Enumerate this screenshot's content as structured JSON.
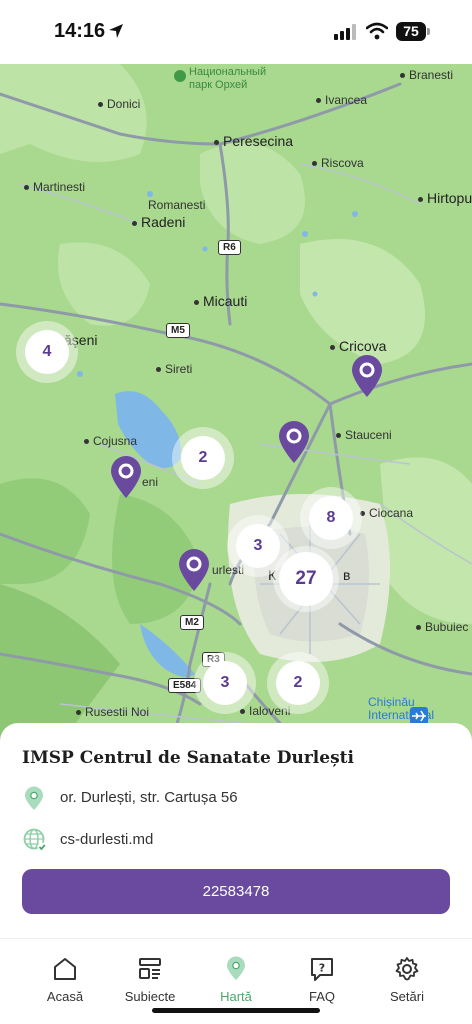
{
  "status": {
    "time": "14:16",
    "battery": "75"
  },
  "map": {
    "park": {
      "line1": "Национальный",
      "line2": "парк Орхей"
    },
    "places": [
      {
        "id": "branesti",
        "label": "Branesti"
      },
      {
        "id": "donici",
        "label": "Donici"
      },
      {
        "id": "ivancea",
        "label": "Ivancea"
      },
      {
        "id": "peresecina",
        "label": "Peresecina"
      },
      {
        "id": "riscova",
        "label": "Riscova"
      },
      {
        "id": "martinesti",
        "label": "Martinesti"
      },
      {
        "id": "romanesti",
        "label": "Romanesti"
      },
      {
        "id": "hirtopul",
        "label": "Hirtopul"
      },
      {
        "id": "radeni",
        "label": "Radeni"
      },
      {
        "id": "micauti",
        "label": "Micauti"
      },
      {
        "id": "cricova",
        "label": "Cricova"
      },
      {
        "id": "baccesti",
        "label": "ăşeni"
      },
      {
        "id": "sireti",
        "label": "Sireti"
      },
      {
        "id": "stauceni",
        "label": "Stauceni"
      },
      {
        "id": "cojusna",
        "label": "Cojusna"
      },
      {
        "id": "bacioieni",
        "label": "eni"
      },
      {
        "id": "ciocana",
        "label": "Ciocana"
      },
      {
        "id": "durlesti",
        "label": "urlesti"
      },
      {
        "id": "chisinau",
        "label": "К"
      },
      {
        "id": "chisinau2",
        "label": "в"
      },
      {
        "id": "bubuieci",
        "label": "Bubuiec"
      },
      {
        "id": "rusestii",
        "label": "Rusestii Noi"
      },
      {
        "id": "ialoveni",
        "label": "Ialoveni"
      }
    ],
    "roads": {
      "r6": "R6",
      "m5": "M5",
      "m2": "M2",
      "r3": "R3",
      "e584": "E584"
    },
    "airport": {
      "line1": "Chișinău",
      "line2": "International"
    },
    "clusters": [
      {
        "id": "c4",
        "count": "4"
      },
      {
        "id": "c2a",
        "count": "2"
      },
      {
        "id": "c8",
        "count": "8"
      },
      {
        "id": "c3a",
        "count": "3"
      },
      {
        "id": "c27",
        "count": "27"
      },
      {
        "id": "c3b",
        "count": "3"
      },
      {
        "id": "c2b",
        "count": "2"
      }
    ]
  },
  "sheet": {
    "title": "IMSP Centrul de Sanatate Durlești",
    "address": "or. Durlești, str. Cartușa 56",
    "website": "cs-durlesti.md",
    "phone": "22583478"
  },
  "tabs": [
    {
      "id": "acasa",
      "label": "Acasă",
      "icon": "home-icon"
    },
    {
      "id": "subiecte",
      "label": "Subiecte",
      "icon": "topics-icon"
    },
    {
      "id": "harta",
      "label": "Hartă",
      "icon": "map-pin-icon",
      "active": true
    },
    {
      "id": "faq",
      "label": "FAQ",
      "icon": "faq-icon"
    },
    {
      "id": "setari",
      "label": "Setări",
      "icon": "gear-icon"
    }
  ],
  "colors": {
    "accent": "#6a4a9e",
    "active_tab": "#4aa86a",
    "map_green": "#a9d88f"
  }
}
